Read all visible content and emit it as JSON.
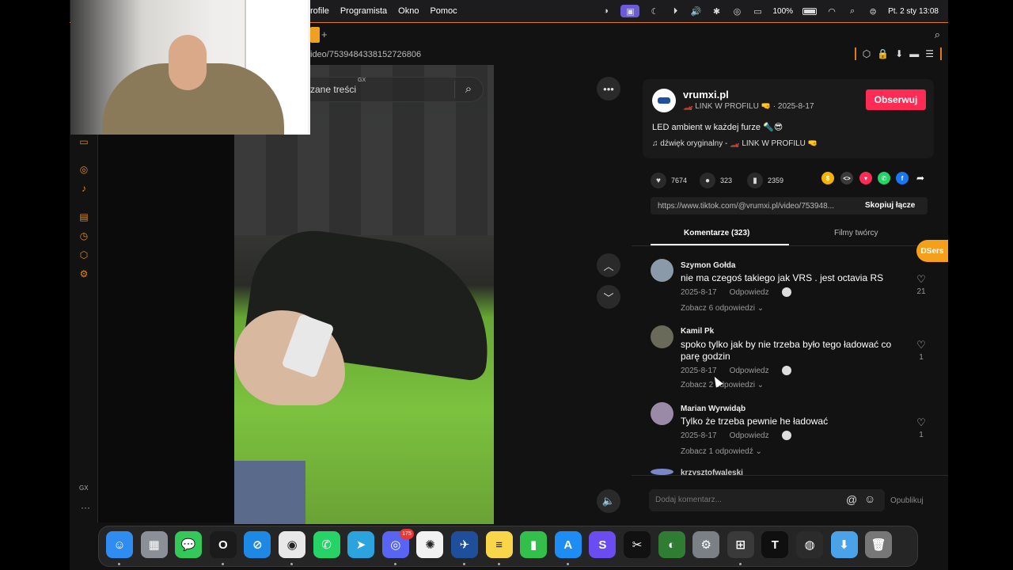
{
  "menubar": {
    "menus": [
      "rofile",
      "Programista",
      "Okno",
      "Pomoc"
    ],
    "battery_percent": "100%",
    "datetime": "Pt. 2 sty  13:08"
  },
  "browser": {
    "url": "ideo/7539484338152726806",
    "new_tab_label": "+"
  },
  "search": {
    "text": "zane treści",
    "gx_tag": "GX"
  },
  "sidebar": {
    "bottom_label": "GX",
    "dots": "···"
  },
  "creator": {
    "name": "vrumxi.pl",
    "meta": "🏎️ LINK W PROFILU 🤜 · 2025-8-17",
    "follow_label": "Obserwuj",
    "caption": "LED ambient w każdej furze 🔦😎",
    "sound": "♫  dźwięk oryginalny - 🏎️ LINK W PROFILU 🤜"
  },
  "stats": {
    "likes": "7674",
    "comments": "323",
    "saves": "2359"
  },
  "link": {
    "url": "https://www.tiktok.com/@vrumxi.pl/video/753948...",
    "copy_label": "Skopiuj łącze"
  },
  "tabs": {
    "comments": "Komentarze (323)",
    "films": "Filmy twórcy"
  },
  "dsers_label": "DSers",
  "comments": [
    {
      "author": "Szymon Gołda",
      "text": "nie ma czegoś takiego jak VRS . jest octavia RS",
      "date": "2025-8-17",
      "reply_label": "Odpowiedz",
      "replies": "Zobacz 6 odpowiedzi ⌄",
      "likes": "21"
    },
    {
      "author": "Kamil Pk",
      "text": "spoko tylko jak by nie trzeba było tego ładować co parę godzin",
      "date": "2025-8-17",
      "reply_label": "Odpowiedz",
      "replies": "Zobacz 2 odpowiedzi ⌄",
      "likes": "1"
    },
    {
      "author": "Marian Wyrwidąb",
      "text": "Tylko że trzeba pewnie he ładować",
      "date": "2025-8-17",
      "reply_label": "Odpowiedz",
      "replies": "Zobacz 1 odpowiedź ⌄",
      "likes": "1"
    }
  ],
  "comment_cutoff": "krzysztofwaleski",
  "comment_input": {
    "placeholder": "Dodaj komentarz...",
    "publish_label": "Opublikuj"
  },
  "dock": {
    "discord_badge": "175",
    "apps": [
      {
        "name": "finder",
        "glyph": "☺",
        "color": "#2f8cf0"
      },
      {
        "name": "launchpad",
        "glyph": "▦",
        "color": "#8a8f98"
      },
      {
        "name": "messages",
        "glyph": "💬",
        "color": "#34c759"
      },
      {
        "name": "opera",
        "glyph": "O",
        "color": "#1b1b1b"
      },
      {
        "name": "safari",
        "glyph": "⊘",
        "color": "#1e88e5"
      },
      {
        "name": "chrome",
        "glyph": "◉",
        "color": "#e8e8e8"
      },
      {
        "name": "whatsapp",
        "glyph": "✆",
        "color": "#25d366"
      },
      {
        "name": "telegram",
        "glyph": "➤",
        "color": "#2aa3df"
      },
      {
        "name": "discord",
        "glyph": "◎",
        "color": "#5865f2"
      },
      {
        "name": "chatgpt",
        "glyph": "✺",
        "color": "#f2f2f2"
      },
      {
        "name": "testflight",
        "glyph": "✈",
        "color": "#1f4f9a"
      },
      {
        "name": "notes",
        "glyph": "≡",
        "color": "#f9d54a"
      },
      {
        "name": "numbers",
        "glyph": "▮",
        "color": "#33c04a"
      },
      {
        "name": "app-store",
        "glyph": "A",
        "color": "#1d8df3"
      },
      {
        "name": "setapp",
        "glyph": "S",
        "color": "#6a4cf0"
      },
      {
        "name": "capcut",
        "glyph": "✂",
        "color": "#111111"
      },
      {
        "name": "ai-app",
        "glyph": "◐",
        "color": "#2e7d32"
      },
      {
        "name": "system-settings",
        "glyph": "⚙",
        "color": "#7b7f86"
      },
      {
        "name": "calculator",
        "glyph": "⊞",
        "color": "#3a3a3a"
      },
      {
        "name": "tradingview",
        "glyph": "T",
        "color": "#0f0f0f"
      },
      {
        "name": "obs",
        "glyph": "◍",
        "color": "#2b2b2b"
      },
      {
        "name": "downloads-folder",
        "glyph": "⬇",
        "color": "#4aa3e8"
      },
      {
        "name": "trash",
        "glyph": "🗑",
        "color": "#777777"
      }
    ]
  }
}
